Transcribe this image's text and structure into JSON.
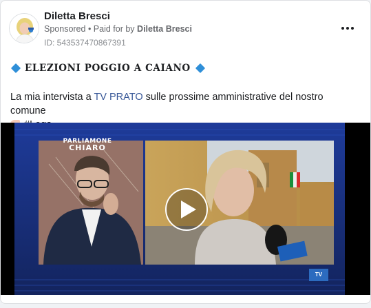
{
  "post": {
    "page_name": "Diletta Bresci",
    "sponsored_label": "Sponsored",
    "paid_for_prefix": "• Paid for by",
    "paid_for_by": "Diletta Bresci",
    "ad_id": "ID: 543537470867391",
    "headline": "ELEZIONI POGGIO A CAIANO",
    "text_before_link": "La mia intervista a ",
    "link_text": "TV PRATO",
    "text_after_link": " sulle prossime amministrative del nostro comune",
    "hashtag": "#Lega"
  },
  "video": {
    "show_logo_line1": "PARLIAMONE",
    "show_logo_line2": "CHIARO",
    "channel_logo": "TV"
  },
  "icons": {
    "diamond": "small-blue-diamond-icon",
    "hand": "backhand-index-pointing-left-icon",
    "more": "more-options-icon",
    "play": "play-icon"
  },
  "colors": {
    "link": "#385898",
    "diamond": "#2f8fd8",
    "video_bg": "#1b2a6b"
  }
}
